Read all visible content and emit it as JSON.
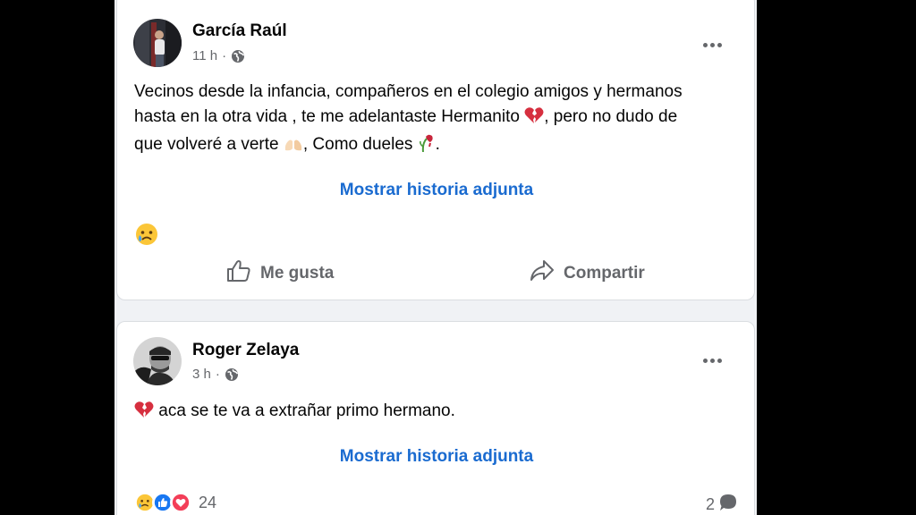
{
  "posts": [
    {
      "author": "García Raúl",
      "time": "11 h",
      "separator": "·",
      "privacy_icon": "globe-icon",
      "text_line1": "Vecinos desde la infancia, compañeros en el colegio amigos y hermanos",
      "text_line2a": "hasta en la otra vida , te me adelantaste Hermanito ",
      "text_line2b": ", pero no dudo de",
      "text_line3a": "que volveré a verte ",
      "text_line3b": ", Como dueles ",
      "text_line3c": ".",
      "story_link": "Mostrar historia adjunta",
      "reaction_emoji": "sad-cry-face",
      "like_label": "Me gusta",
      "share_label": "Compartir"
    },
    {
      "author": "Roger Zelaya",
      "time": "3 h",
      "separator": "·",
      "privacy_icon": "globe-icon",
      "text": "aca se te va a extrañar primo hermano.",
      "story_link": "Mostrar historia adjunta",
      "reaction_count": "24",
      "comment_count": "2"
    }
  ],
  "colors": {
    "link_blue": "#1a6bd0",
    "secondary_text": "#65676b",
    "primary_text": "#050505",
    "like_blue": "#1877f2",
    "love_red": "#f33e58"
  }
}
